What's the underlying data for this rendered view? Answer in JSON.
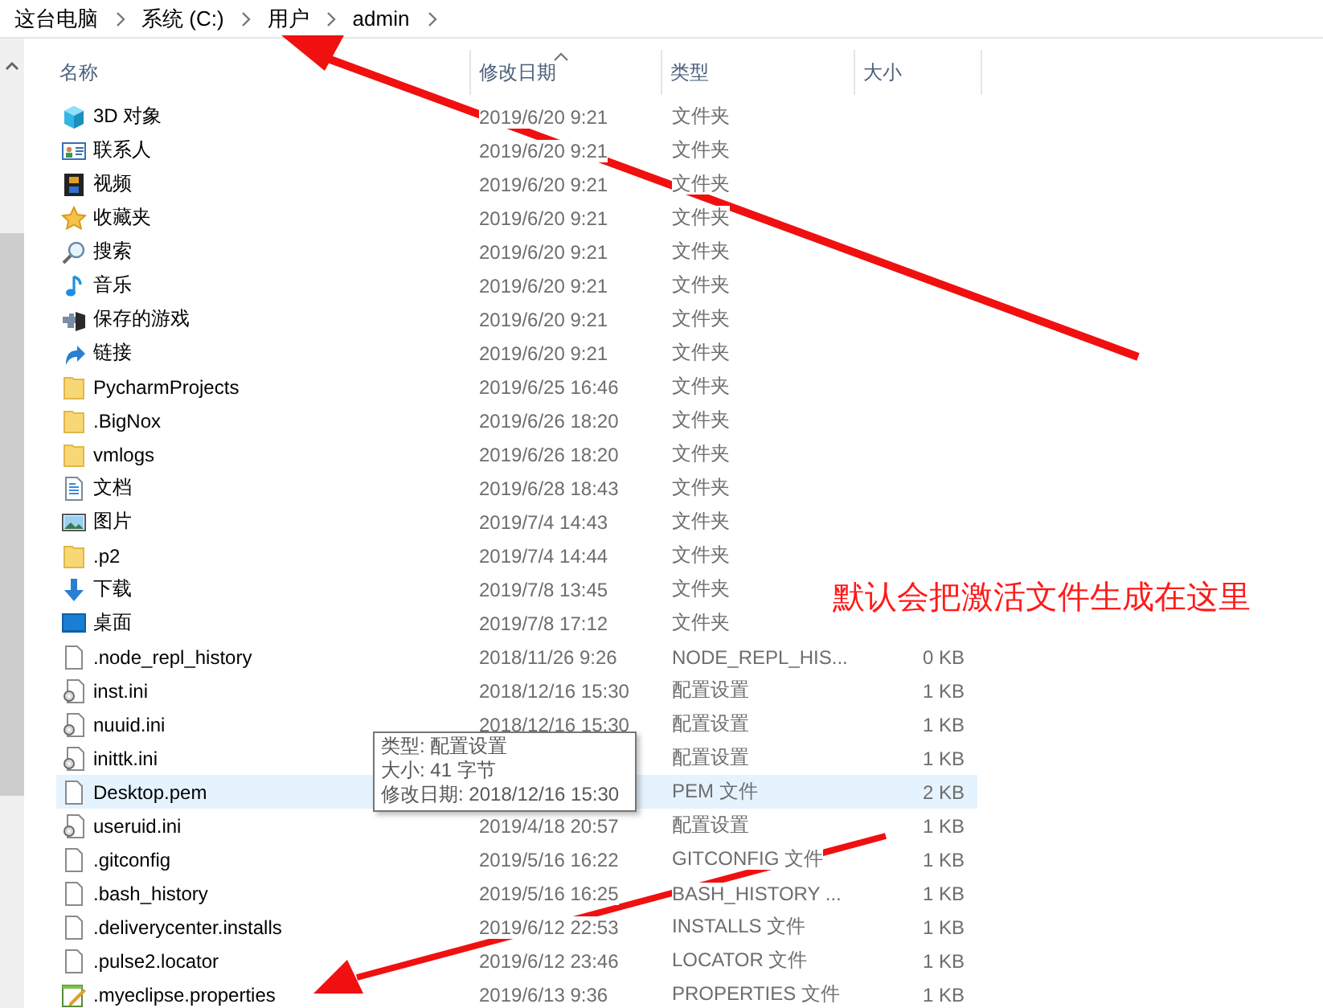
{
  "breadcrumb": [
    {
      "label": "这台电脑"
    },
    {
      "label": "系统 (C:)"
    },
    {
      "label": "用户"
    },
    {
      "label": "admin"
    }
  ],
  "columns": [
    {
      "label": "名称",
      "sorted": false
    },
    {
      "label": "修改日期",
      "sorted": true
    },
    {
      "label": "类型",
      "sorted": false
    },
    {
      "label": "大小",
      "sorted": false
    }
  ],
  "rows": [
    {
      "kind": "cube",
      "name": "3D 对象",
      "date": "2019/6/20 9:21",
      "type": "文件夹",
      "highlighted": false
    },
    {
      "kind": "contacts",
      "name": "联系人",
      "date": "2019/6/20 9:21",
      "type": "文件夹",
      "highlighted": false
    },
    {
      "kind": "video",
      "name": "视频",
      "date": "2019/6/20 9:21",
      "type": "文件夹",
      "highlighted": false
    },
    {
      "kind": "star",
      "name": "收藏夹",
      "date": "2019/6/20 9:21",
      "type": "文件夹",
      "highlighted": false
    },
    {
      "kind": "search",
      "name": "搜索",
      "date": "2019/6/20 9:21",
      "type": "文件夹",
      "highlighted": false
    },
    {
      "kind": "music",
      "name": "音乐",
      "date": "2019/6/20 9:21",
      "type": "文件夹",
      "highlighted": false
    },
    {
      "kind": "games",
      "name": "保存的游戏",
      "date": "2019/6/20 9:21",
      "type": "文件夹",
      "highlighted": false
    },
    {
      "kind": "link",
      "name": "链接",
      "date": "2019/6/20 9:21",
      "type": "文件夹",
      "highlighted": false
    },
    {
      "kind": "folder",
      "name": "PycharmProjects",
      "date": "2019/6/25 16:46",
      "type": "文件夹",
      "highlighted": false
    },
    {
      "kind": "folder",
      "name": ".BigNox",
      "date": "2019/6/26 18:20",
      "type": "文件夹",
      "highlighted": false
    },
    {
      "kind": "folder",
      "name": "vmlogs",
      "date": "2019/6/26 18:20",
      "type": "文件夹",
      "highlighted": false
    },
    {
      "kind": "documents",
      "name": "文档",
      "date": "2019/6/28 18:43",
      "type": "文件夹",
      "highlighted": false
    },
    {
      "kind": "pictures",
      "name": "图片",
      "date": "2019/7/4 14:43",
      "type": "文件夹",
      "highlighted": false
    },
    {
      "kind": "folder",
      "name": ".p2",
      "date": "2019/7/4 14:44",
      "type": "文件夹",
      "highlighted": false
    },
    {
      "kind": "download",
      "name": "下载",
      "date": "2019/7/8 13:45",
      "type": "文件夹",
      "highlighted": false
    },
    {
      "kind": "desktop",
      "name": "桌面",
      "date": "2019/7/8 17:12",
      "type": "文件夹",
      "highlighted": false
    },
    {
      "kind": "file",
      "name": ".node_repl_history",
      "date": "2018/11/26 9:26",
      "type": "NODE_REPL_HIS...",
      "size": "0 KB",
      "highlighted": false
    },
    {
      "kind": "settings",
      "name": "inst.ini",
      "date": "2018/12/16 15:30",
      "type": "配置设置",
      "size": "1 KB",
      "highlighted": false
    },
    {
      "kind": "settings",
      "name": "nuuid.ini",
      "date": "2018/12/16 15:30",
      "type": "配置设置",
      "size": "1 KB",
      "highlighted": false
    },
    {
      "kind": "settings",
      "name": "inittk.ini",
      "type": "配置设置",
      "size": "1 KB",
      "highlighted": false
    },
    {
      "kind": "file",
      "name": "Desktop.pem",
      "type": "PEM 文件",
      "size": "2 KB",
      "highlighted": true
    },
    {
      "kind": "settings",
      "name": "useruid.ini",
      "date": "2019/4/18 20:57",
      "type": "配置设置",
      "size": "1 KB",
      "highlighted": false
    },
    {
      "kind": "file",
      "name": ".gitconfig",
      "date": "2019/5/16 16:22",
      "type": "GITCONFIG 文件",
      "size": "1 KB",
      "highlighted": false
    },
    {
      "kind": "file",
      "name": ".bash_history",
      "date": "2019/5/16 16:25",
      "type": "BASH_HISTORY ...",
      "size": "1 KB",
      "highlighted": false
    },
    {
      "kind": "file",
      "name": ".deliverycenter.installs",
      "date": "2019/6/12 22:53",
      "type": "INSTALLS 文件",
      "size": "1 KB",
      "highlighted": false
    },
    {
      "kind": "file",
      "name": ".pulse2.locator",
      "date": "2019/6/12 23:46",
      "type": "LOCATOR 文件",
      "size": "1 KB",
      "highlighted": false
    },
    {
      "kind": "properties",
      "name": ".myeclipse.properties",
      "date": "2019/6/13 9:36",
      "type": "PROPERTIES 文件",
      "size": "1 KB",
      "highlighted": false
    }
  ],
  "tooltip": {
    "lines": [
      "类型: 配置设置",
      "大小: 41 字节",
      "修改日期: 2018/12/16 15:30"
    ]
  },
  "annotation": {
    "note": "默认会把激活文件生成在这里"
  }
}
